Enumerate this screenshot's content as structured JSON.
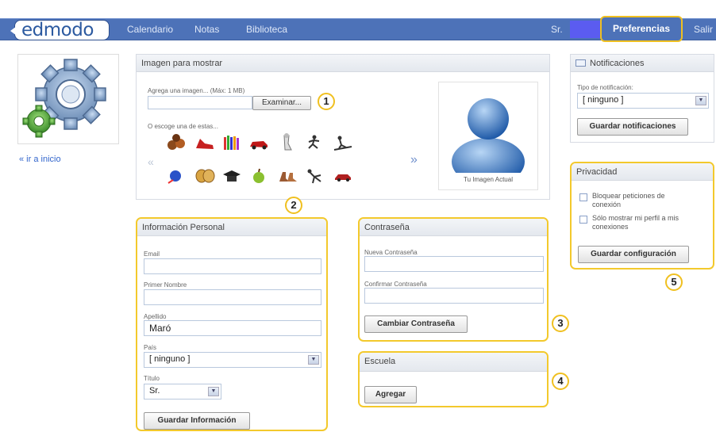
{
  "nav": {
    "logo": "edmodo",
    "links": [
      "Calendario",
      "Notas",
      "Biblioteca"
    ],
    "user_prefix": "Sr.",
    "preferences": "Preferencias",
    "logout": "Salir"
  },
  "sidebar": {
    "back_link": "« ir a inicio"
  },
  "image_panel": {
    "title": "Imagen para mostrar",
    "upload_label": "Agrega una imagen... (Máx: 1 MB)",
    "browse_button": "Examinar...",
    "choose_label": "O escoge una de estas...",
    "current_caption": "Tu Imagen Actual",
    "prev_arrow": "«",
    "next_arrow": "»"
  },
  "personal": {
    "title": "Información Personal",
    "email_label": "Email",
    "email_value": "",
    "first_name_label": "Primer Nombre",
    "first_name_value": "",
    "last_name_label": "Apellido",
    "last_name_value": "Maró",
    "country_label": "País",
    "country_value": "[ ninguno ]",
    "title_label": "Título",
    "title_value": "Sr.",
    "save_button": "Guardar Información"
  },
  "password": {
    "title": "Contraseña",
    "new_label": "Nueva Contraseña",
    "confirm_label": "Confirmar Contraseña",
    "change_button": "Cambiar Contraseña"
  },
  "school": {
    "title": "Escuela",
    "add_button": "Agregar"
  },
  "notifications": {
    "title": "Notificaciones",
    "type_label": "Tipo de notificación:",
    "type_value": "[ ninguno ]",
    "save_button": "Guardar notificaciones"
  },
  "privacy": {
    "title": "Privacidad",
    "block_label": "Bloquear peticiones de conexión",
    "only_connections_label": "Sólo mostrar mi perfil a mis conexiones",
    "save_button": "Guardar configuración"
  },
  "callouts": [
    "1",
    "2",
    "3",
    "4",
    "5"
  ]
}
